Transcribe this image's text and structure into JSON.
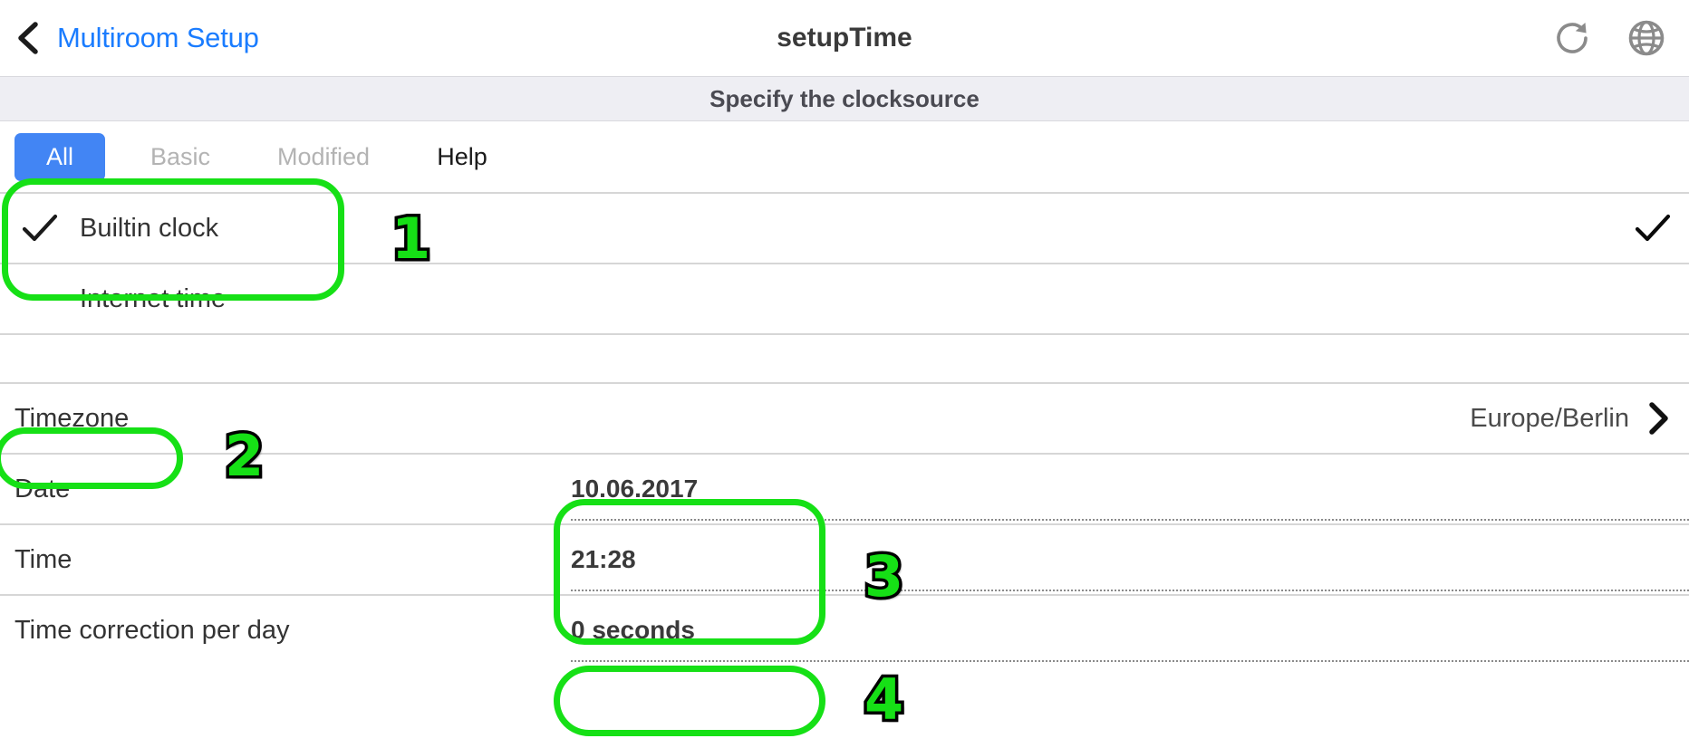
{
  "header": {
    "back_label": "Multiroom Setup",
    "back_icon": "chevron-left-icon",
    "title": "setupTime",
    "refresh_icon": "refresh-icon",
    "globe_icon": "globe-icon"
  },
  "subtitle": {
    "text": "Specify the clocksource"
  },
  "tabs": [
    {
      "label": "All",
      "state": "active"
    },
    {
      "label": "Basic",
      "state": "disabled"
    },
    {
      "label": "Modified",
      "state": "disabled"
    },
    {
      "label": "Help",
      "state": "normal"
    }
  ],
  "clocksource": {
    "options": [
      {
        "label": "Builtin clock",
        "selected": true,
        "left_check_icon": "check-icon",
        "right_check_icon": "check-icon"
      },
      {
        "label": "Internet time",
        "selected": false
      }
    ]
  },
  "settings": {
    "timezone": {
      "label": "Timezone",
      "value": "Europe/Berlin",
      "chevron_icon": "chevron-right-icon"
    },
    "date": {
      "label": "Date",
      "value": "10.06.2017"
    },
    "time": {
      "label": "Time",
      "value": "21:28"
    },
    "time_correction": {
      "label": "Time correction per day",
      "value": "0 seconds"
    }
  },
  "annotations": [
    {
      "number": "1"
    },
    {
      "number": "2"
    },
    {
      "number": "3"
    },
    {
      "number": "4"
    }
  ],
  "colors": {
    "accent_blue": "#4285f4",
    "link_blue": "#1a7cff",
    "annotation_green": "#16e016",
    "subtitle_bg": "#eeeef3"
  }
}
